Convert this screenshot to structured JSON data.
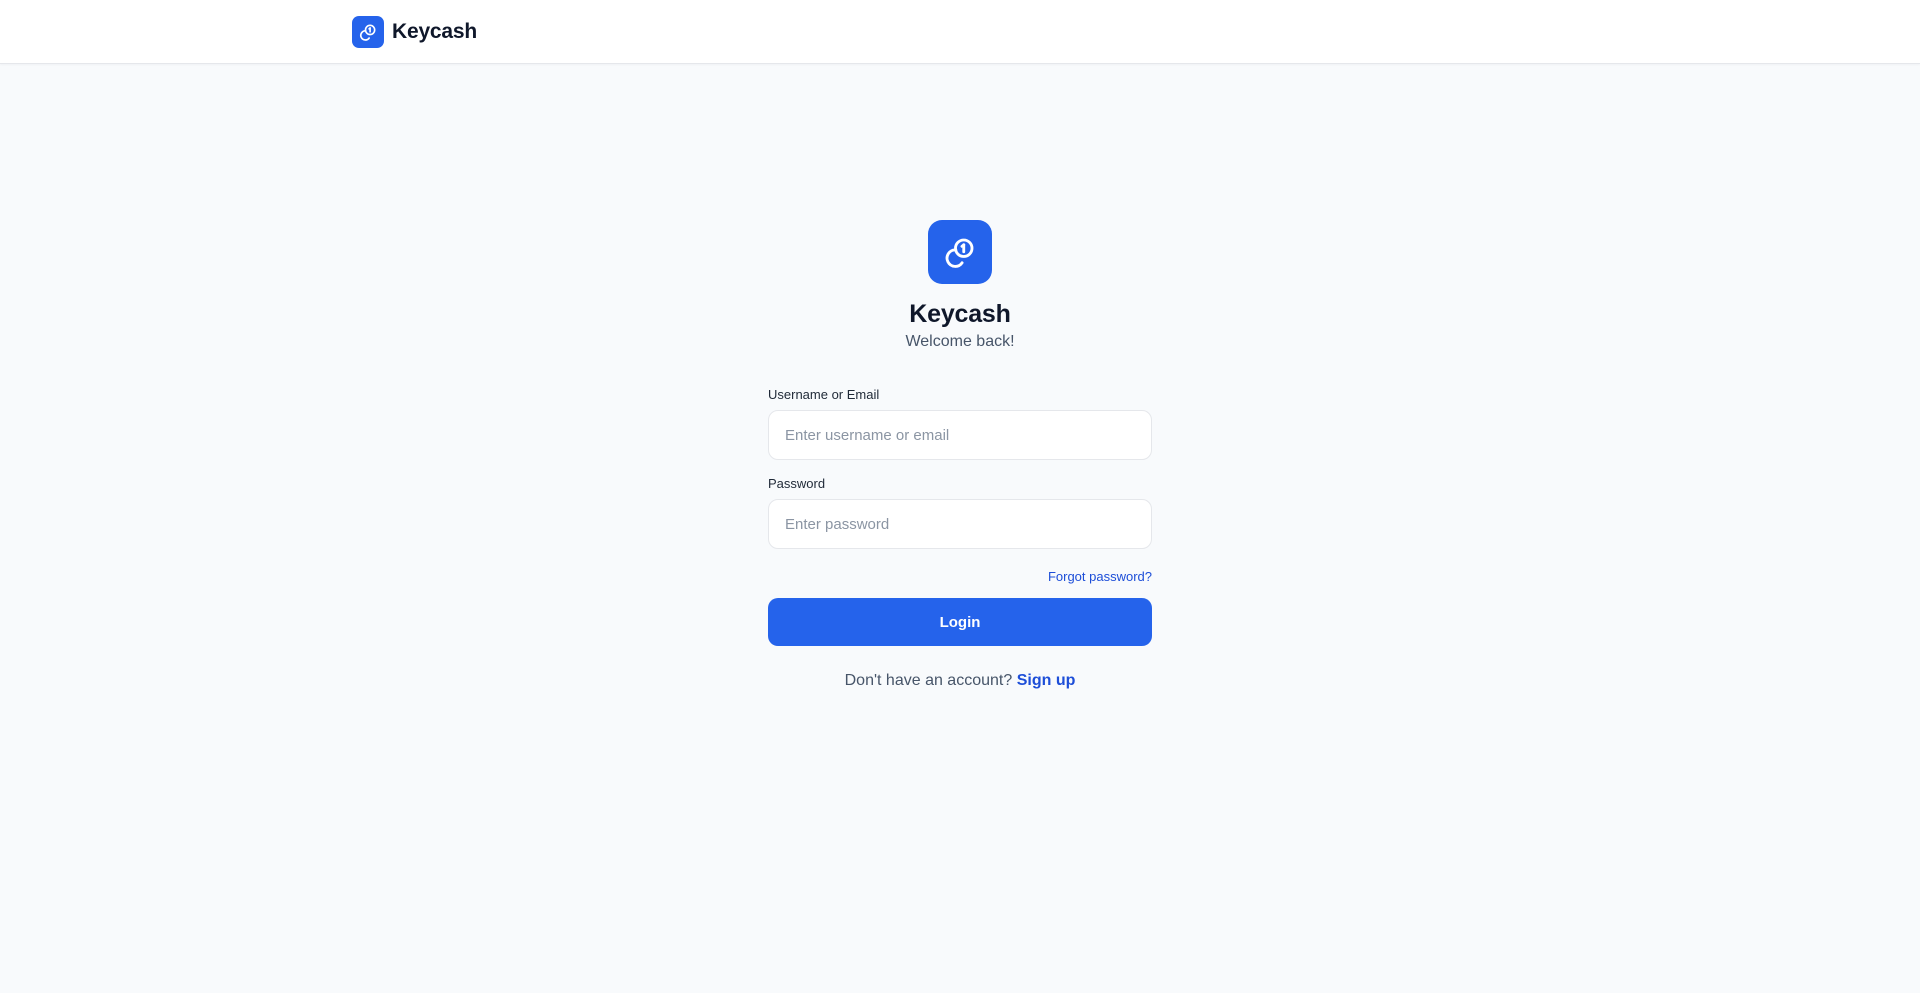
{
  "app": {
    "name": "Keycash",
    "accent_color": "#2563eb",
    "logo_icon": "link-coin-icon"
  },
  "header": {
    "brand_name": "Keycash"
  },
  "login": {
    "title": "Keycash",
    "subtitle": "Welcome back!",
    "username": {
      "label": "Username or Email",
      "placeholder": "Enter username or email",
      "value": ""
    },
    "password": {
      "label": "Password",
      "placeholder": "Enter password",
      "value": ""
    },
    "forgot_password_label": "Forgot password?",
    "login_button_label": "Login",
    "signup_prompt": "Don't have an account?",
    "signup_link_label": "Sign up"
  }
}
